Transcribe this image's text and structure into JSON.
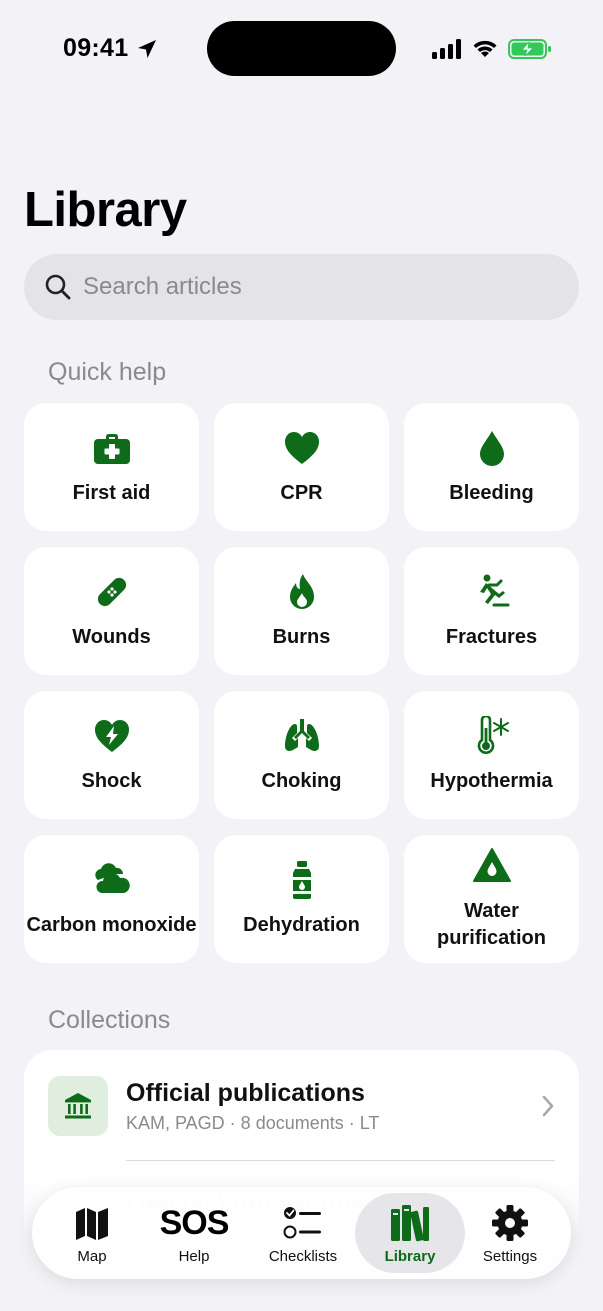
{
  "status": {
    "time": "09:41"
  },
  "page": {
    "title": "Library"
  },
  "search": {
    "placeholder": "Search articles"
  },
  "quick_help": {
    "title": "Quick help",
    "items": [
      {
        "label": "First aid",
        "icon": "first-aid-kit-icon"
      },
      {
        "label": "CPR",
        "icon": "heart-icon"
      },
      {
        "label": "Bleeding",
        "icon": "drop-icon"
      },
      {
        "label": "Wounds",
        "icon": "bandage-icon"
      },
      {
        "label": "Burns",
        "icon": "flame-icon"
      },
      {
        "label": "Fractures",
        "icon": "falling-person-icon"
      },
      {
        "label": "Shock",
        "icon": "heart-bolt-icon"
      },
      {
        "label": "Choking",
        "icon": "lungs-icon"
      },
      {
        "label": "Hypothermia",
        "icon": "thermometer-snowflake-icon"
      },
      {
        "label": "Carbon monoxide",
        "icon": "smoke-cloud-icon"
      },
      {
        "label": "Dehydration",
        "icon": "water-bottle-icon"
      },
      {
        "label": "Water purification",
        "icon": "triangle-drop-icon"
      }
    ]
  },
  "collections": {
    "title": "Collections",
    "items": [
      {
        "title": "Official publications",
        "subtitle": "KAM, PAGD · 8 documents · LT",
        "icon": "building-columns-icon"
      }
    ]
  },
  "tabbar": {
    "tabs": [
      {
        "label": "Map",
        "icon": "map-icon"
      },
      {
        "label": "Help",
        "icon": "sos-icon",
        "icon_text": "SOS"
      },
      {
        "label": "Checklists",
        "icon": "checklist-icon"
      },
      {
        "label": "Library",
        "icon": "books-icon",
        "active": true
      },
      {
        "label": "Settings",
        "icon": "gear-icon"
      }
    ]
  },
  "colors": {
    "accent": "#0d6b19",
    "background": "#f2f2f7",
    "card": "#ffffff",
    "secondary_text": "#8a8a8e",
    "battery_green": "#34c759"
  }
}
